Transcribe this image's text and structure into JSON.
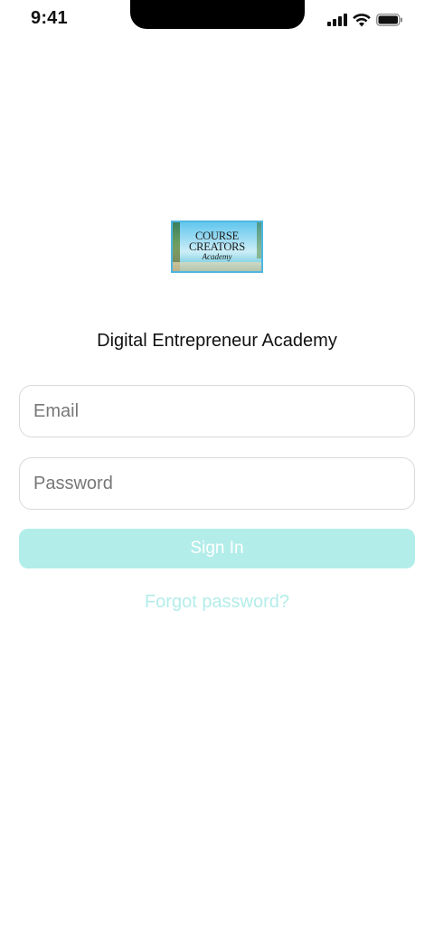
{
  "status_bar": {
    "time": "9:41",
    "icons": [
      "cellular-signal-icon",
      "wifi-icon",
      "battery-icon"
    ]
  },
  "logo": {
    "line1": "COURSE",
    "line2": "CREATORS",
    "line3": "Academy"
  },
  "app": {
    "title": "Digital Entrepreneur Academy"
  },
  "login_form": {
    "email": {
      "value": "",
      "placeholder": "Email"
    },
    "password": {
      "value": "",
      "placeholder": "Password"
    },
    "sign_in_label": "Sign In",
    "forgot_password_label": "Forgot password?"
  },
  "colors": {
    "accent": "#b3ede9",
    "text": "#111111",
    "border": "#d9d9d9",
    "placeholder": "#777777"
  }
}
